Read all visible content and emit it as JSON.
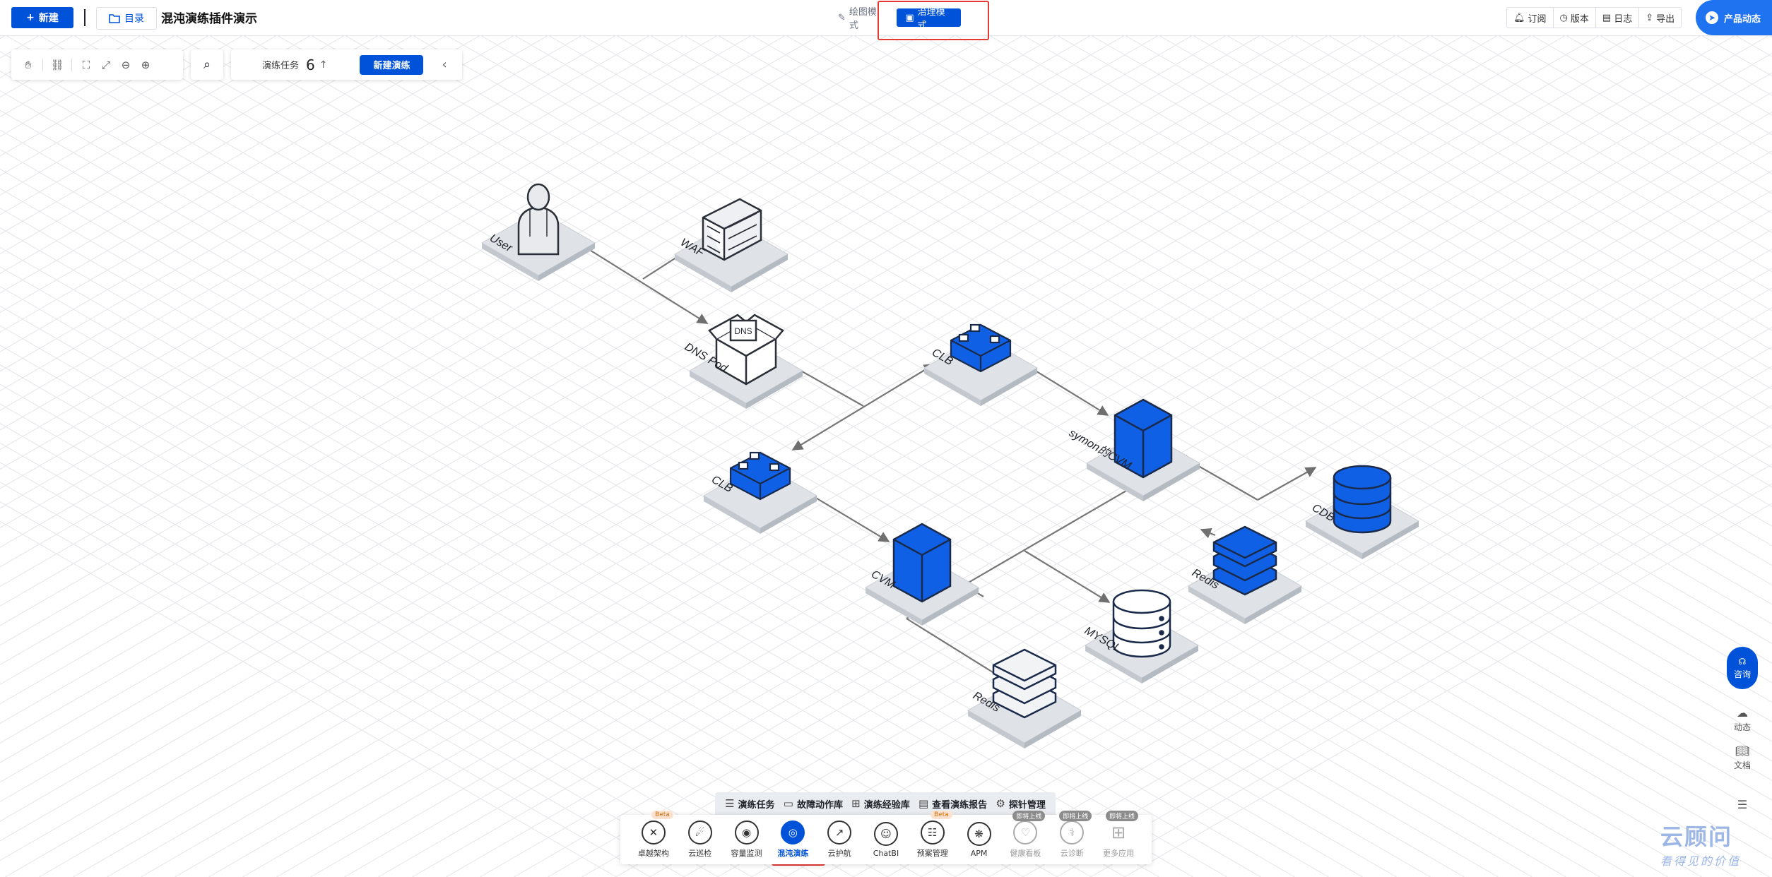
{
  "header": {
    "new_button": "新建",
    "directory_button": "目录",
    "title": "混沌演练插件演示",
    "modes": [
      {
        "label": "绘图模式",
        "icon": "pencil-icon",
        "active": false
      },
      {
        "label": "治理模式",
        "icon": "monitor-icon",
        "active": true
      }
    ],
    "actions": [
      {
        "label": "订阅",
        "icon": "bell-icon"
      },
      {
        "label": "版本",
        "icon": "clock-icon"
      },
      {
        "label": "日志",
        "icon": "document-icon"
      },
      {
        "label": "导出",
        "icon": "export-icon"
      }
    ],
    "product_news": "产品动态"
  },
  "toolbar": {
    "tools": [
      "hand-icon",
      "link-icon",
      "fit-screen-icon",
      "fullscreen-icon",
      "zoom-out-icon",
      "zoom-in-icon"
    ],
    "search_icon": "search-icon"
  },
  "drill_bar": {
    "label": "演练任务",
    "count": "6",
    "new_drill": "新建演练"
  },
  "diagram": {
    "nodes": [
      {
        "id": "user",
        "label": "User",
        "type": "user"
      },
      {
        "id": "waf",
        "label": "WAF",
        "type": "firewall"
      },
      {
        "id": "dns",
        "label": "DNS Pod",
        "type": "dns",
        "inner_text": "DNS"
      },
      {
        "id": "clb1",
        "label": "CLB",
        "type": "clb"
      },
      {
        "id": "clb2",
        "label": "CLB",
        "type": "clb"
      },
      {
        "id": "symon",
        "label": "symon的CVM",
        "type": "server"
      },
      {
        "id": "cvm",
        "label": "CVM",
        "type": "server"
      },
      {
        "id": "cdb",
        "label": "CDB",
        "type": "db-blue"
      },
      {
        "id": "redis1",
        "label": "Redis",
        "type": "stack-blue"
      },
      {
        "id": "mysql",
        "label": "MYSQL",
        "type": "db-white"
      },
      {
        "id": "redis2",
        "label": "Redis",
        "type": "stack-white"
      }
    ]
  },
  "bottom_tabs": [
    {
      "label": "演练任务",
      "icon": "list-icon"
    },
    {
      "label": "故障动作库",
      "icon": "library-icon"
    },
    {
      "label": "演练经验库",
      "icon": "grid-icon"
    },
    {
      "label": "查看演练报告",
      "icon": "report-icon"
    },
    {
      "label": "探针管理",
      "icon": "gear-icon"
    }
  ],
  "apps": [
    {
      "label": "卓越架构",
      "icon": "architecture-icon",
      "badge": "Beta",
      "badge_type": "beta",
      "state": "normal"
    },
    {
      "label": "云巡检",
      "icon": "inspection-icon",
      "badge": "",
      "badge_type": "",
      "state": "normal"
    },
    {
      "label": "容量监测",
      "icon": "eye-icon",
      "badge": "",
      "badge_type": "",
      "state": "normal"
    },
    {
      "label": "混沌演练",
      "icon": "chaos-icon",
      "badge": "",
      "badge_type": "",
      "state": "active"
    },
    {
      "label": "云护航",
      "icon": "escort-icon",
      "badge": "",
      "badge_type": "",
      "state": "normal"
    },
    {
      "label": "ChatBI",
      "icon": "robot-icon",
      "badge": "",
      "badge_type": "",
      "state": "normal"
    },
    {
      "label": "预案管理",
      "icon": "plan-icon",
      "badge": "Beta",
      "badge_type": "beta",
      "state": "normal"
    },
    {
      "label": "APM",
      "icon": "apm-icon",
      "badge": "",
      "badge_type": "",
      "state": "normal"
    },
    {
      "label": "健康看板",
      "icon": "health-icon",
      "badge": "即将上线",
      "badge_type": "gray",
      "state": "dim"
    },
    {
      "label": "云诊断",
      "icon": "diagnosis-icon",
      "badge": "即将上线",
      "badge_type": "gray",
      "state": "dim"
    },
    {
      "label": "更多应用",
      "icon": "more-apps-icon",
      "badge": "即将上线",
      "badge_type": "gray",
      "state": "dim"
    }
  ],
  "right_panel": {
    "consult": "咨询",
    "dynamic": "动态",
    "docs": "文档"
  },
  "watermark": {
    "main": "云顾问",
    "sub": "看得见的价值"
  },
  "colors": {
    "primary": "#0052d9",
    "node_blue": "#1060e6",
    "platform": "#d9dde3",
    "highlight": "#e53935"
  }
}
